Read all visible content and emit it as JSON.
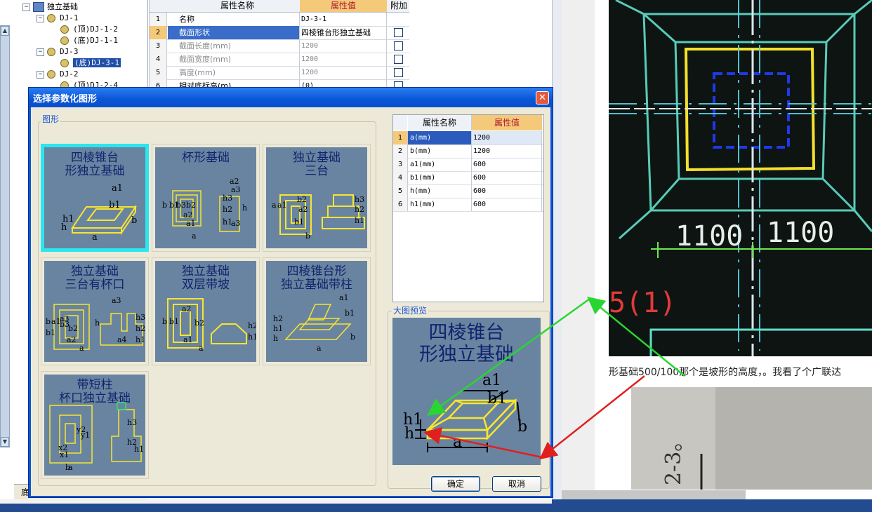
{
  "tree": {
    "items": [
      {
        "label": "独立基础",
        "level": 0,
        "toggle": "⊟",
        "type": "root"
      },
      {
        "label": "DJ-1",
        "level": 1,
        "toggle": "⊟",
        "type": "node"
      },
      {
        "label": "(顶)DJ-1-2",
        "level": 2,
        "toggle": "",
        "type": "leaf"
      },
      {
        "label": "(底)DJ-1-1",
        "level": 2,
        "toggle": "",
        "type": "leaf"
      },
      {
        "label": "DJ-3",
        "level": 1,
        "toggle": "⊟",
        "type": "node"
      },
      {
        "label": "(底)DJ-3-1",
        "level": 2,
        "toggle": "",
        "type": "leaf",
        "selected": true
      },
      {
        "label": "DJ-2",
        "level": 1,
        "toggle": "⊟",
        "type": "node"
      },
      {
        "label": "(顶)DJ-2-4",
        "level": 2,
        "toggle": "",
        "type": "leaf"
      }
    ],
    "bottom_tab": "底"
  },
  "bg_grid": {
    "header": {
      "name": "属性名称",
      "value": "属性值",
      "extra": "附加"
    },
    "rows": [
      {
        "num": "1",
        "name": "名称",
        "value": "DJ-3-1",
        "checkbox": false,
        "dim": false
      },
      {
        "num": "2",
        "name": "截面形状",
        "value": "四棱锥台形独立基础",
        "checkbox": true,
        "dim": false,
        "selected": true
      },
      {
        "num": "3",
        "name": "截面长度(mm)",
        "value": "1200",
        "checkbox": true,
        "dim": true
      },
      {
        "num": "4",
        "name": "截面宽度(mm)",
        "value": "1200",
        "checkbox": true,
        "dim": true
      },
      {
        "num": "5",
        "name": "高度(mm)",
        "value": "1200",
        "checkbox": true,
        "dim": true
      },
      {
        "num": "6",
        "name": "相对底标高(m)",
        "value": "(0)",
        "checkbox": true,
        "dim": false
      }
    ]
  },
  "dialog": {
    "title": "选择参数化图形",
    "close_glyph": "✕",
    "group_label": "图形",
    "preview_label": "大图预览",
    "ok_label": "确定",
    "cancel_label": "取消",
    "shapes": [
      {
        "id": "s1",
        "label": "四棱锥台\n形独立基础",
        "selected": true
      },
      {
        "id": "s2",
        "label": "杯形基础",
        "selected": false
      },
      {
        "id": "s3",
        "label": "独立基础\n三台",
        "selected": false
      },
      {
        "id": "s4",
        "label": "独立基础\n三台有杯口",
        "selected": false
      },
      {
        "id": "s5",
        "label": "独立基础\n双层带坡",
        "selected": false
      },
      {
        "id": "s6",
        "label": "四棱锥台形\n独立基础带柱",
        "selected": false
      },
      {
        "id": "s7",
        "label": "带短柱\n杯口独立基础",
        "selected": false
      }
    ],
    "attr_table": {
      "header": {
        "name": "属性名称",
        "value": "属性值"
      },
      "rows": [
        {
          "num": "1",
          "name": "a(mm)",
          "value": "1200"
        },
        {
          "num": "2",
          "name": "b(mm)",
          "value": "1200"
        },
        {
          "num": "3",
          "name": "a1(mm)",
          "value": "600"
        },
        {
          "num": "4",
          "name": "b1(mm)",
          "value": "600"
        },
        {
          "num": "5",
          "name": "h(mm)",
          "value": "600"
        },
        {
          "num": "6",
          "name": "h1(mm)",
          "value": "600"
        }
      ]
    },
    "preview": {
      "title": "四棱锥台\n形独立基础",
      "labels": {
        "a1": "a1",
        "b1": "b1",
        "h1": "h1",
        "h": "h",
        "a": "a",
        "b": "b"
      }
    },
    "shape_dims": {
      "s1": [
        "a1",
        "b1",
        "h1",
        "h",
        "a",
        "b"
      ],
      "s2": [
        "a2",
        "a3",
        "b",
        "b1",
        "b3",
        "b2",
        "a2",
        "a1",
        "h3",
        "h2",
        "h",
        "h1",
        "a3",
        "a"
      ],
      "s3": [
        "a",
        "a1",
        "b2",
        "a2",
        "b1",
        "h3",
        "h2",
        "h1",
        "b"
      ],
      "s4": [
        "a3",
        "b",
        "b1",
        "a1",
        "a3",
        "b3",
        "b2",
        "a2",
        "h",
        "a4",
        "h3",
        "h2",
        "h1",
        "a"
      ],
      "s5": [
        "b",
        "b1",
        "a2",
        "b2",
        "a1",
        "h2",
        "h1",
        "a"
      ],
      "s6": [
        "a1",
        "b1",
        "h2",
        "h1",
        "h",
        "b",
        "a"
      ],
      "s7": [
        "b",
        "a",
        "h3",
        "h2",
        "h1",
        "x2",
        "x1",
        "y1",
        "y2"
      ]
    }
  },
  "photo": {
    "dim_left": "1100",
    "dim_right": "1100",
    "axis_mark": "5(1)"
  },
  "caption": "形基础500/100那个是坡形的高度，。我看了个广联达",
  "photo2": {
    "handwriting": "2-3。"
  },
  "colors": {
    "tile_bg": "#6984a0",
    "tile_text": "#10246e",
    "shape_line": "#f7e531",
    "dialog_title": "#0a55d6",
    "arrow_green": "#29d631",
    "arrow_red": "#e0201e",
    "header_orange": "#f4c97a",
    "header_text_red": "#b0142c"
  }
}
